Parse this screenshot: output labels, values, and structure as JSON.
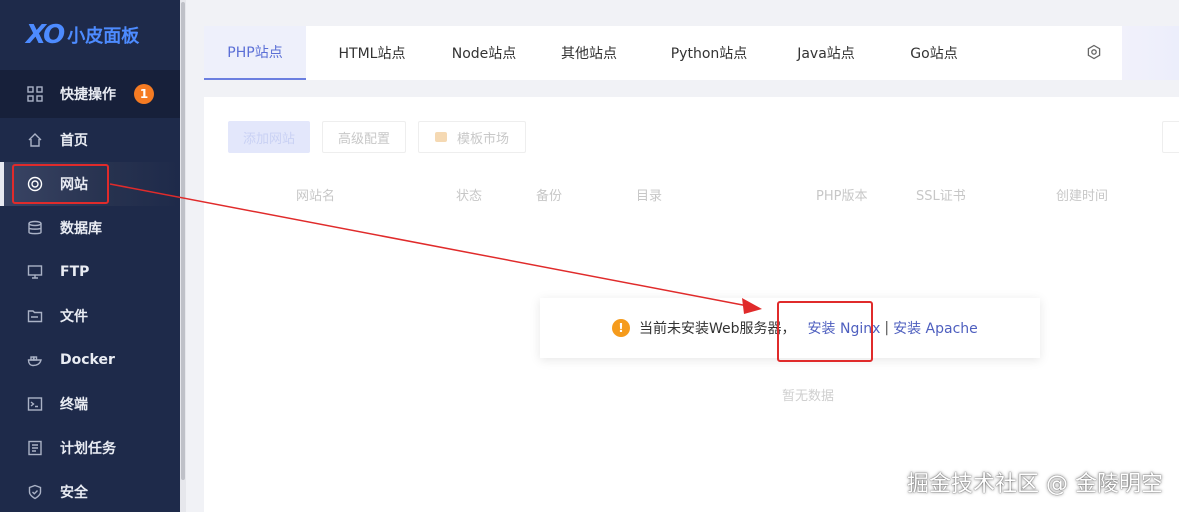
{
  "logo": {
    "mark": "XO",
    "name": "小皮面板"
  },
  "sidebar": {
    "items": [
      {
        "label": "快捷操作",
        "badge": "1",
        "icon": "grid-icon"
      },
      {
        "label": "首页",
        "icon": "home-icon"
      },
      {
        "label": "网站",
        "icon": "globe-icon"
      },
      {
        "label": "数据库",
        "icon": "database-icon"
      },
      {
        "label": "FTP",
        "icon": "ftp-icon"
      },
      {
        "label": "文件",
        "icon": "folder-icon"
      },
      {
        "label": "Docker",
        "icon": "docker-icon"
      },
      {
        "label": "终端",
        "icon": "terminal-icon"
      },
      {
        "label": "计划任务",
        "icon": "task-list-icon"
      },
      {
        "label": "安全",
        "icon": "shield-icon"
      }
    ]
  },
  "tabs": [
    "PHP站点",
    "HTML站点",
    "Node站点",
    "其他站点",
    "Python站点",
    "Java站点",
    "Go站点"
  ],
  "toolbar": {
    "add": "添加网站",
    "advanced": "高级配置",
    "template": "模板市场"
  },
  "table": {
    "headers": [
      "网站名",
      "状态",
      "备份",
      "目录",
      "PHP版本",
      "SSL证书",
      "创建时间"
    ],
    "empty": "暂无数据"
  },
  "notice": {
    "icon": "!",
    "text": "当前未安装Web服务器，",
    "nginx": "安装 Nginx",
    "separator": "|",
    "apache": "安装 Apache"
  },
  "watermark": "掘金技术社区 @ 金陵明空",
  "colors": {
    "sidebar": "#1e2a4a",
    "accent": "#5b6fd6",
    "annotation": "#e02b2b",
    "warning": "#f59b1c",
    "badge": "#f57b23"
  }
}
